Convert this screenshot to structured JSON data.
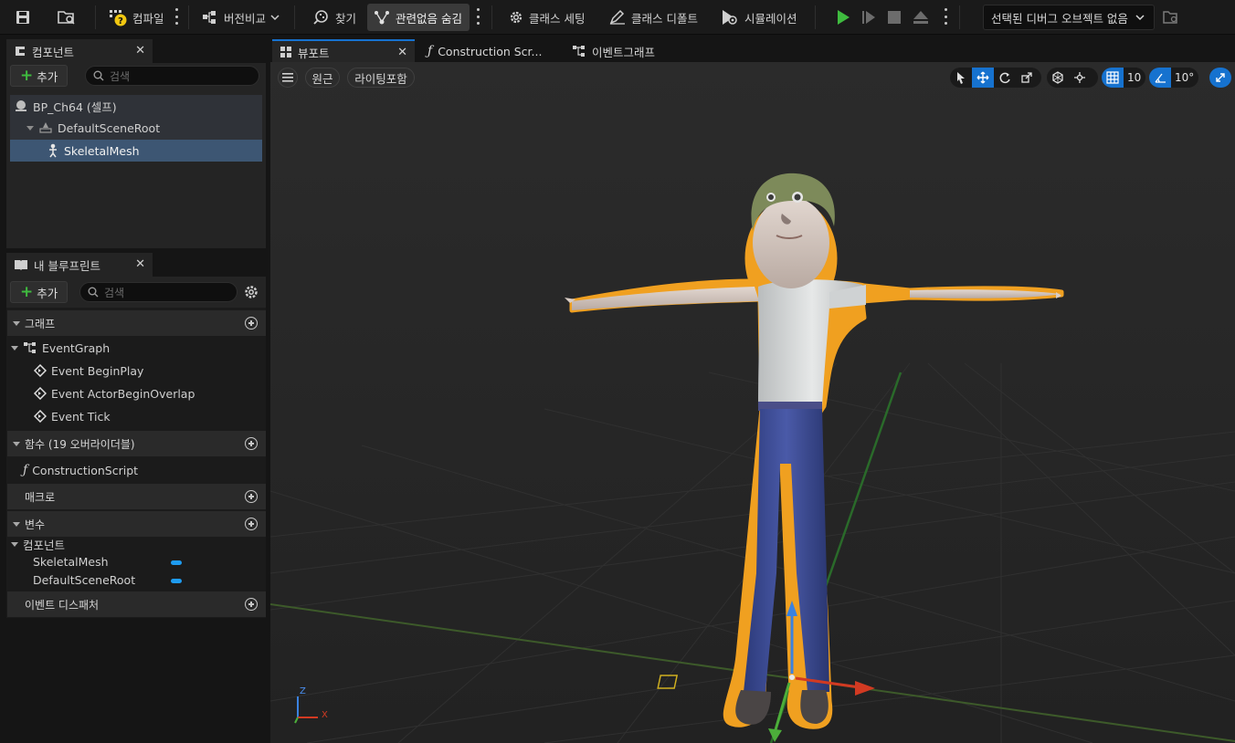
{
  "toolbar": {
    "compile": "컴파일",
    "diff": "버전비교",
    "find": "찾기",
    "hide_unrelated": "관련없음 숨김",
    "class_settings": "클래스 세팅",
    "class_defaults": "클래스 디폴트",
    "simulation": "시뮬레이션",
    "debug_object": "선택된 디버그 오브젝트 없음"
  },
  "components_panel": {
    "tab_label": "컴포넌트",
    "add_label": "추가",
    "search_placeholder": "검색",
    "tree": [
      {
        "label": "BP_Ch64 (셀프)"
      },
      {
        "label": "DefaultSceneRoot"
      },
      {
        "label": "SkeletalMesh"
      }
    ]
  },
  "my_blueprint": {
    "tab_label": "내 블루프린트",
    "add_label": "추가",
    "search_placeholder": "검색",
    "graphs_header": "그래프",
    "event_graph": "EventGraph",
    "events": [
      "Event BeginPlay",
      "Event ActorBeginOverlap",
      "Event Tick"
    ],
    "functions_header": "함수 (19 오버라이더블)",
    "construction_script": "ConstructionScript",
    "macros_header": "매크로",
    "variables_header": "변수",
    "components_group": "컴포넌트",
    "variables": [
      "SkeletalMesh",
      "DefaultSceneRoot"
    ],
    "dispatchers_header": "이벤트 디스패처"
  },
  "editor_tabs": [
    {
      "label": "뷰포트"
    },
    {
      "label": "Construction Scr..."
    },
    {
      "label": "이벤트그래프"
    }
  ],
  "viewport": {
    "perspective": "원근",
    "lit": "라이팅포함",
    "grid_snap": "10",
    "rot_snap": "10°",
    "axis_x": "X",
    "axis_z": "Z"
  },
  "colors": {
    "accent_blue": "#1672cf",
    "selection_outline": "#f0a020",
    "play_green": "#3fbb3f"
  }
}
